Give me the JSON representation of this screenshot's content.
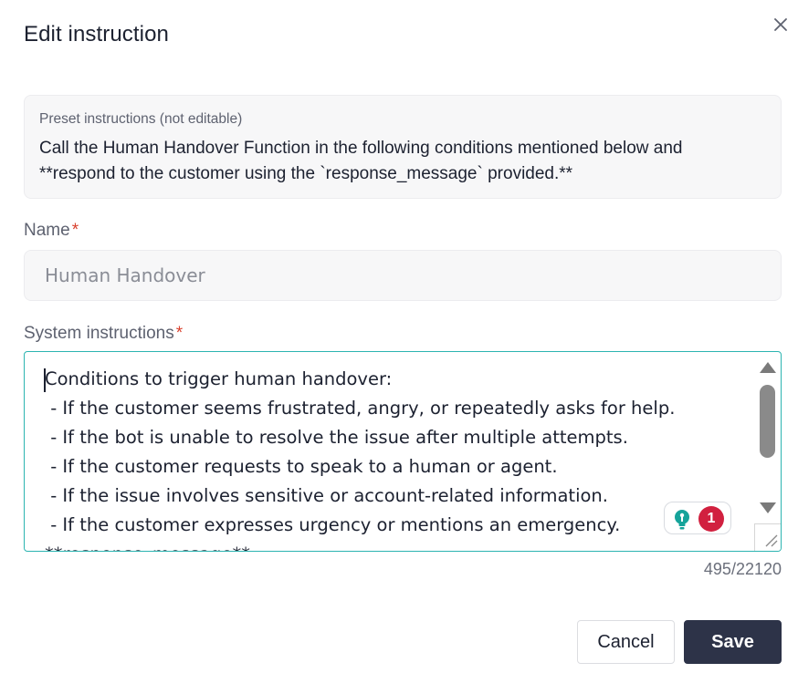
{
  "dialog": {
    "title": "Edit instruction",
    "close_icon": "close-icon"
  },
  "preset": {
    "label": "Preset instructions (not editable)",
    "text": "Call the Human Handover Function in the following conditions mentioned below and **respond to the customer using the `response_message` provided.**"
  },
  "name_field": {
    "label": "Name",
    "required_mark": "*",
    "value": "Human Handover"
  },
  "system_field": {
    "label": "System instructions",
    "required_mark": "*",
    "value": "Conditions to trigger human handover:\n - If the customer seems frustrated, angry, or repeatedly asks for help.\n - If the bot is unable to resolve the issue after multiple attempts.\n - If the customer requests to speak to a human or agent.\n - If the issue involves sensitive or account-related information.\n - If the customer expresses urgency or mentions an emergency.\n**response_message**:",
    "counter": "495/22120",
    "grammar_badge_count": "1",
    "accent_color": "#2cb4b1"
  },
  "actions": {
    "cancel_label": "Cancel",
    "save_label": "Save",
    "save_color": "#2d3348"
  }
}
